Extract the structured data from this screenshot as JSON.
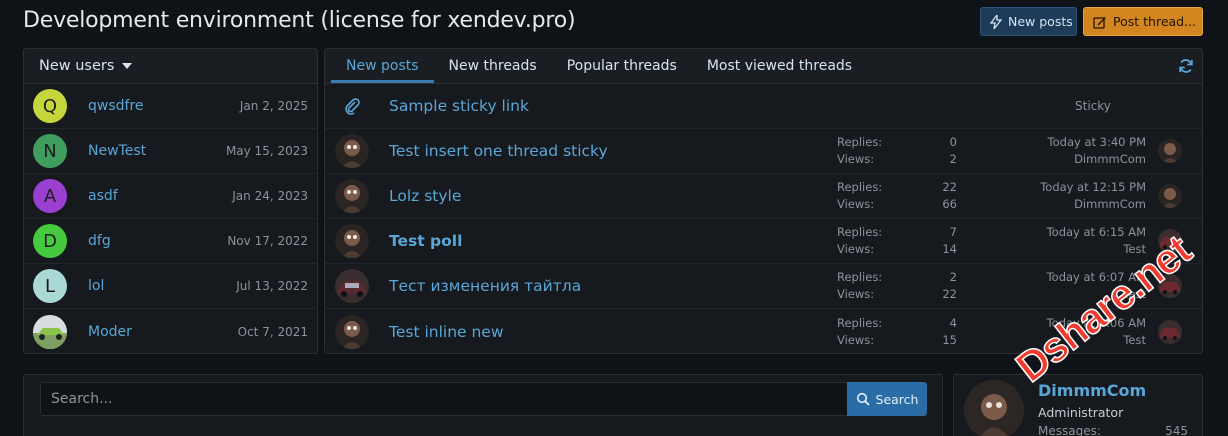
{
  "page": {
    "title": "Development environment (license for xendev.pro)"
  },
  "header_buttons": {
    "new_posts": "New posts",
    "post_thread": "Post thread..."
  },
  "new_users": {
    "title": "New users",
    "items": [
      {
        "name": "qwsdfre",
        "date": "Jan 2, 2025",
        "initial": "Q",
        "color": "#c4d63c"
      },
      {
        "name": "NewTest",
        "date": "May 15, 2023",
        "initial": "N",
        "color": "#3f9e5e"
      },
      {
        "name": "asdf",
        "date": "Jan 24, 2023",
        "initial": "A",
        "color": "#9a3fd0"
      },
      {
        "name": "dfg",
        "date": "Nov 17, 2022",
        "initial": "D",
        "color": "#45c93d"
      },
      {
        "name": "lol",
        "date": "Jul 13, 2022",
        "initial": "L",
        "color": "#a9d8d5"
      },
      {
        "name": "Moder",
        "date": "Oct 7, 2021",
        "initial": "",
        "color": "#8fb38a"
      }
    ]
  },
  "tabs": [
    "New posts",
    "New threads",
    "Popular threads",
    "Most viewed threads"
  ],
  "threads": {
    "sticky": {
      "title": "Sample sticky link",
      "label": "Sticky"
    },
    "stat_labels": {
      "replies": "Replies:",
      "views": "Views:"
    },
    "items": [
      {
        "title": "Test insert one thread sticky",
        "replies": "0",
        "views": "2",
        "time": "Today at 3:40 PM",
        "user": "DimmmCom",
        "bold": false
      },
      {
        "title": "Lolz style",
        "replies": "22",
        "views": "66",
        "time": "Today at 12:15 PM",
        "user": "DimmmCom",
        "bold": false
      },
      {
        "title": "Test poll",
        "replies": "7",
        "views": "14",
        "time": "Today at 6:15 AM",
        "user": "Test",
        "bold": true
      },
      {
        "title": "Тест изменения тайтла",
        "replies": "2",
        "views": "22",
        "time": "Today at 6:07 AM",
        "user": "Test",
        "bold": false
      },
      {
        "title": "Test inline new",
        "replies": "4",
        "views": "15",
        "time": "Today at 6:06 AM",
        "user": "Test",
        "bold": false
      }
    ]
  },
  "search": {
    "placeholder": "Search...",
    "button": "Search"
  },
  "profile": {
    "name": "DimmmCom",
    "role": "Administrator",
    "messages_label": "Messages:",
    "messages": "545"
  },
  "watermark": "Dshare.net"
}
